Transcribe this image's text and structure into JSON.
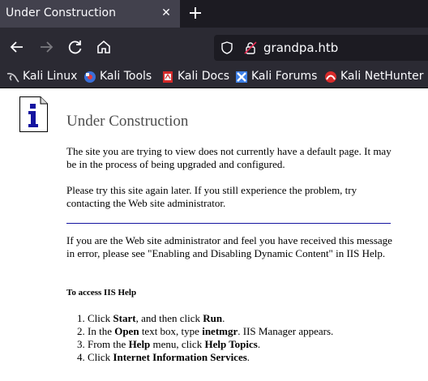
{
  "browser": {
    "tab_title": "Under Construction",
    "tab_close_glyph": "✕",
    "url": "grandpa.htb",
    "bookmarks": [
      {
        "label": "Kali Linux",
        "icon": "kali-dragon-icon"
      },
      {
        "label": "Kali Tools",
        "icon": "kali-tools-icon"
      },
      {
        "label": "Kali Docs",
        "icon": "kali-docs-icon"
      },
      {
        "label": "Kali Forums",
        "icon": "kali-forums-icon"
      },
      {
        "label": "Kali NetHunter",
        "icon": "kali-nethunter-icon"
      }
    ]
  },
  "page": {
    "heading": "Under Construction",
    "para1": "The site you are trying to view does not currently have a default page. It may be in the process of being upgraded and configured.",
    "para2": "Please try this site again later. If you still experience the problem, try contacting the Web site administrator.",
    "para3": "If you are the Web site administrator and feel you have received this message in error, please see \"Enabling and Disabling Dynamic Content\" in IIS Help.",
    "subheading": "To access IIS Help",
    "steps": [
      {
        "pre": "Click ",
        "b1": "Start",
        "mid": ", and then click ",
        "b2": "Run",
        "post": "."
      },
      {
        "pre": "In the ",
        "b1": "Open",
        "mid": " text box, type ",
        "b2": "inetmgr",
        "post": ". IIS Manager appears."
      },
      {
        "pre": "From the ",
        "b1": "Help",
        "mid": " menu, click ",
        "b2": "Help Topics",
        "post": "."
      },
      {
        "pre": "Click ",
        "b1": "Internet Information Services",
        "mid": "",
        "b2": "",
        "post": "."
      }
    ]
  },
  "colors": {
    "tabbar_bg": "#1c1b22",
    "toolbar_bg": "#2b2a33",
    "rule": "#1414a0",
    "heading": "#4e4e4e"
  }
}
